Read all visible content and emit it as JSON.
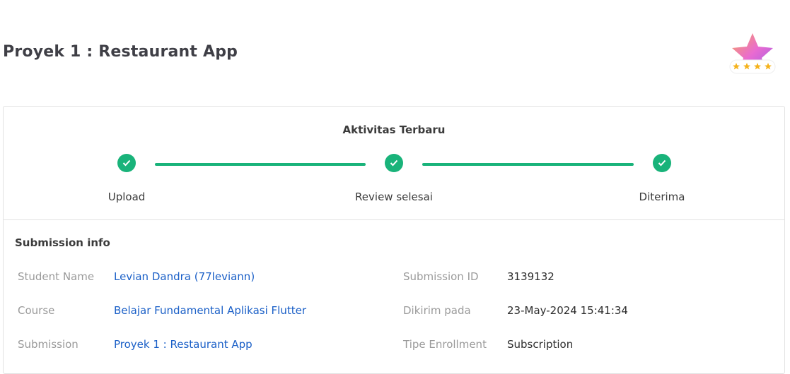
{
  "header": {
    "title": "Proyek 1 : Restaurant App",
    "badge_icon": "star-rating-badge-icon",
    "badge_stars": 4
  },
  "activity": {
    "title": "Aktivitas Terbaru",
    "accent_color": "#19b37a",
    "steps": [
      {
        "label": "Upload",
        "status": "done"
      },
      {
        "label": "Review selesai",
        "status": "done"
      },
      {
        "label": "Diterima",
        "status": "done"
      }
    ]
  },
  "submission_info": {
    "title": "Submission info",
    "link_color": "#1a5fc7",
    "left": [
      {
        "label": "Student Name",
        "value": "Levian Dandra (77leviann)"
      },
      {
        "label": "Course",
        "value": "Belajar Fundamental Aplikasi Flutter"
      },
      {
        "label": "Submission",
        "value": "Proyek 1 : Restaurant App"
      }
    ],
    "right": [
      {
        "label": "Submission ID",
        "value": "3139132"
      },
      {
        "label": "Dikirim pada",
        "value": "23-May-2024 15:41:34"
      },
      {
        "label": "Tipe Enrollment",
        "value": "Subscription"
      }
    ]
  }
}
